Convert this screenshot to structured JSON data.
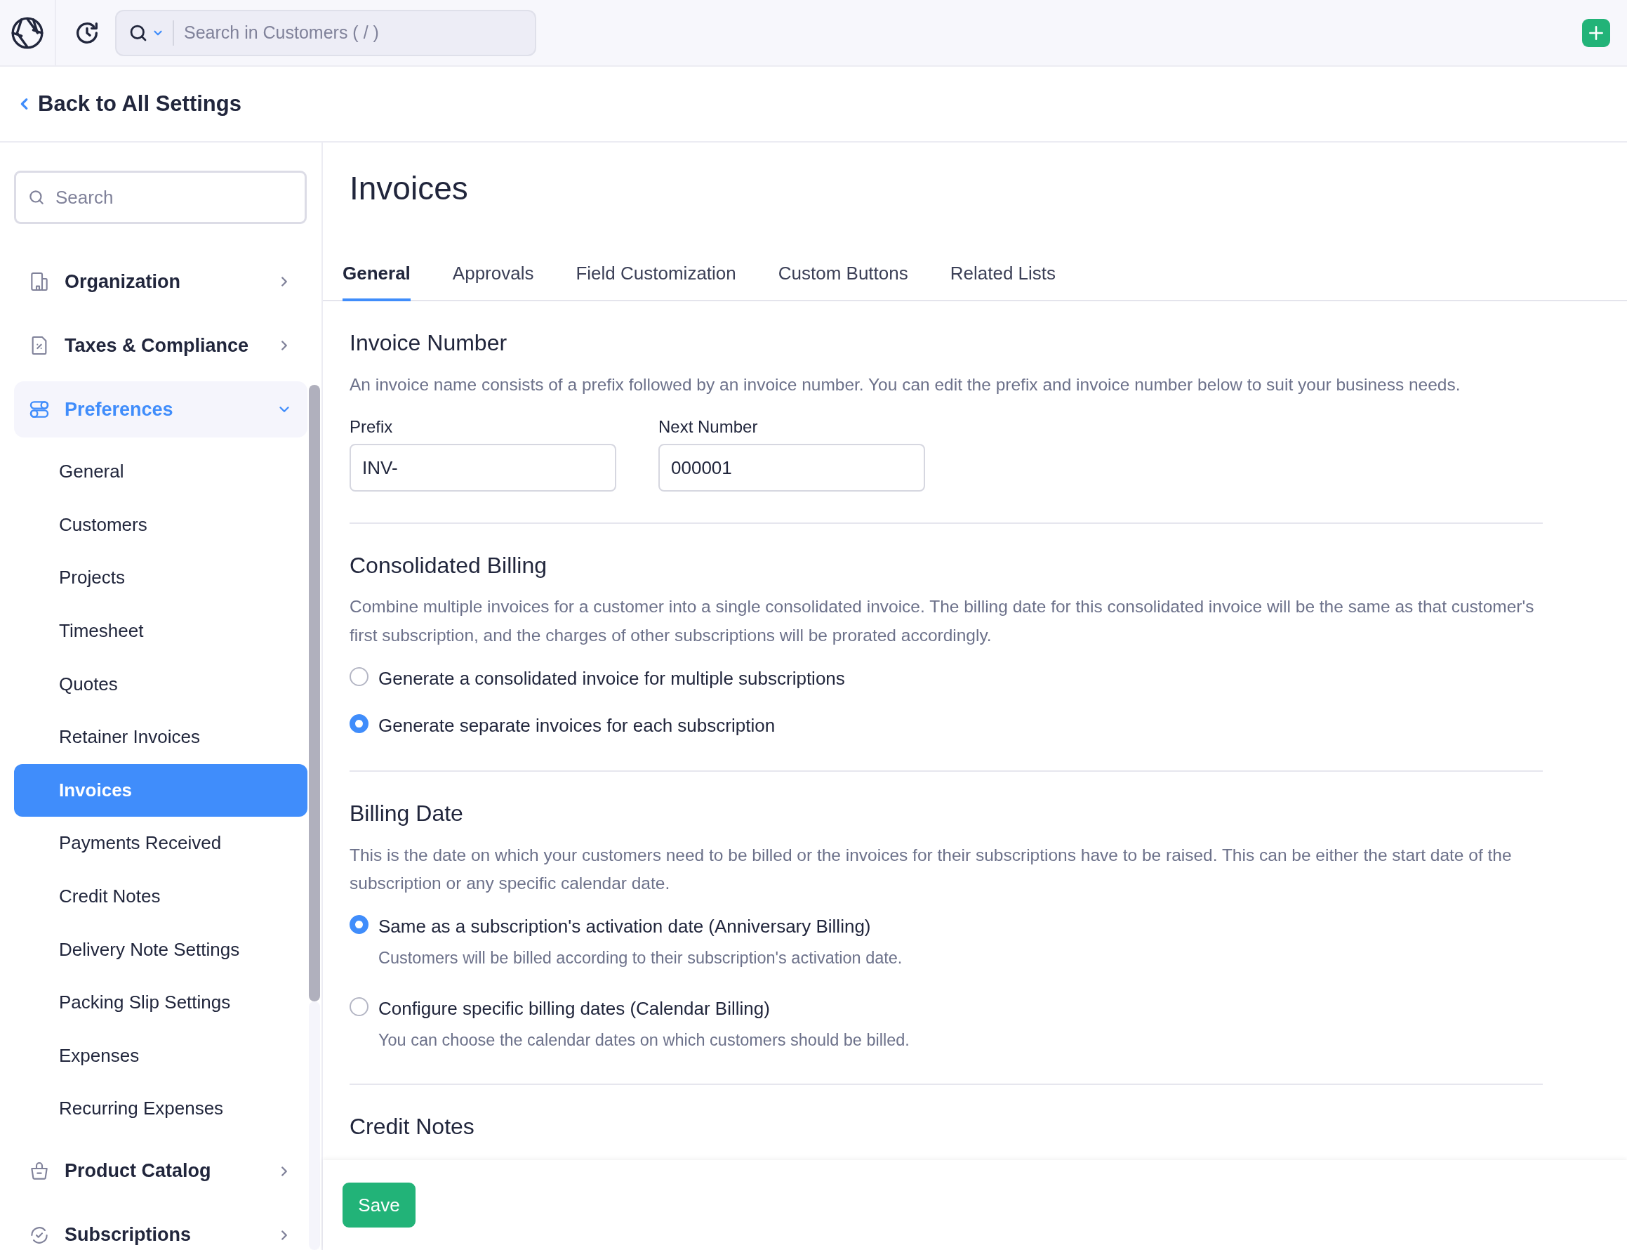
{
  "topbar": {
    "search_placeholder": "Search in Customers ( / )"
  },
  "back_link": "Back to All Settings",
  "sidebar": {
    "search_placeholder": "Search",
    "items": [
      {
        "label": "Organization",
        "expanded": false
      },
      {
        "label": "Taxes & Compliance",
        "expanded": false
      },
      {
        "label": "Preferences",
        "expanded": true,
        "children": [
          {
            "label": "General",
            "selected": false
          },
          {
            "label": "Customers",
            "selected": false
          },
          {
            "label": "Projects",
            "selected": false
          },
          {
            "label": "Timesheet",
            "selected": false
          },
          {
            "label": "Quotes",
            "selected": false
          },
          {
            "label": "Retainer Invoices",
            "selected": false
          },
          {
            "label": "Invoices",
            "selected": true
          },
          {
            "label": "Payments Received",
            "selected": false
          },
          {
            "label": "Credit Notes",
            "selected": false
          },
          {
            "label": "Delivery Note Settings",
            "selected": false
          },
          {
            "label": "Packing Slip Settings",
            "selected": false
          },
          {
            "label": "Expenses",
            "selected": false
          },
          {
            "label": "Recurring Expenses",
            "selected": false
          }
        ]
      },
      {
        "label": "Product Catalog",
        "expanded": false
      },
      {
        "label": "Subscriptions",
        "expanded": false
      }
    ]
  },
  "page": {
    "title": "Invoices",
    "tabs": [
      {
        "label": "General",
        "selected": true
      },
      {
        "label": "Approvals",
        "selected": false
      },
      {
        "label": "Field Customization",
        "selected": false
      },
      {
        "label": "Custom Buttons",
        "selected": false
      },
      {
        "label": "Related Lists",
        "selected": false
      }
    ],
    "sections": [
      {
        "kind": "fields",
        "heading": "Invoice Number",
        "description": "An invoice name consists of a prefix followed by an invoice number. You can edit the prefix and invoice number below to suit your business needs.",
        "fields": [
          {
            "label": "Prefix",
            "value": "INV-"
          },
          {
            "label": "Next Number",
            "value": "000001"
          }
        ]
      },
      {
        "kind": "radios",
        "heading": "Consolidated Billing",
        "description": "Combine multiple invoices for a customer into a single consolidated invoice. The billing date for this consolidated invoice will be the same as that customer's first subscription, and the charges of other subscriptions will be prorated accordingly.",
        "options": [
          {
            "label": "Generate a consolidated invoice for multiple subscriptions",
            "selected": false
          },
          {
            "label": "Generate separate invoices for each subscription",
            "selected": true
          }
        ]
      },
      {
        "kind": "radios",
        "heading": "Billing Date",
        "description": "This is the date on which your customers need to be billed or the invoices for their subscriptions have to be raised. This can be either the start date of the subscription or any specific calendar date.",
        "options": [
          {
            "label": "Same as a subscription's activation date (Anniversary Billing)",
            "hint": "Customers will be billed according to their subscription's activation date.",
            "selected": true
          },
          {
            "label": "Configure specific billing dates (Calendar Billing)",
            "hint": "You can choose the calendar dates on which customers should be billed.",
            "selected": false
          }
        ]
      },
      {
        "kind": "heading",
        "heading": "Credit Notes"
      }
    ]
  },
  "footer": {
    "save_label": "Save"
  }
}
